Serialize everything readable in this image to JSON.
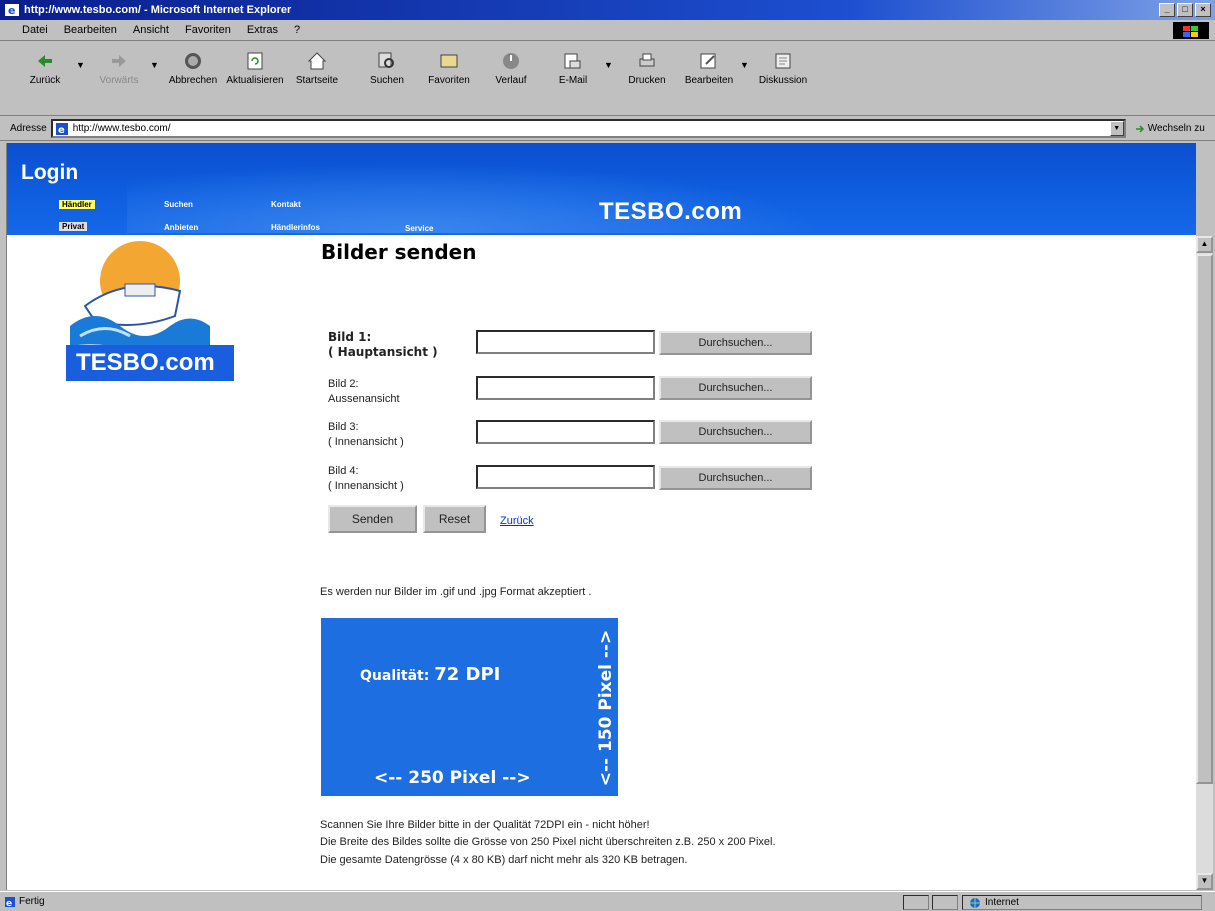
{
  "window": {
    "title": "http://www.tesbo.com/ - Microsoft Internet Explorer",
    "buttons": [
      "_",
      "□",
      "×"
    ]
  },
  "menu": [
    "Datei",
    "Bearbeiten",
    "Ansicht",
    "Favoriten",
    "Extras",
    "?"
  ],
  "toolbar": {
    "back": "Zurück",
    "forward": "Vorwärts",
    "stop": "Abbrechen",
    "refresh": "Aktualisieren",
    "home": "Startseite",
    "search": "Suchen",
    "favorites": "Favoriten",
    "history": "Verlauf",
    "mail": "E-Mail",
    "print": "Drucken",
    "edit": "Bearbeiten",
    "discuss": "Diskussion"
  },
  "address": {
    "label": "Adresse",
    "url": "http://www.tesbo.com/",
    "go": "Wechseln zu"
  },
  "banner": {
    "login": "Login",
    "nav": {
      "haendler": "Händler",
      "privat": "Privat",
      "suchen": "Suchen",
      "anbieten": "Anbieten",
      "kontakt": "Kontakt",
      "haendlerinfos": "Händlerinfos",
      "service": "Service"
    },
    "brand": "TESBO.com"
  },
  "logo_text": "TESBO.com",
  "page": {
    "title": "Bilder senden",
    "rows": [
      {
        "line1": "Bild 1:",
        "line2": "( Hauptansicht )",
        "browse": "Durchsuchen..."
      },
      {
        "line1": "Bild 2:",
        "line2": "Aussenansicht",
        "browse": "Durchsuchen..."
      },
      {
        "line1": "Bild 3:",
        "line2": "( Innenansicht )",
        "browse": "Durchsuchen..."
      },
      {
        "line1": "Bild 4:",
        "line2": "( Innenansicht )",
        "browse": "Durchsuchen..."
      }
    ],
    "send": "Senden",
    "reset": "Reset",
    "back": "Zurück",
    "format_note": "Es werden nur Bilder im .gif und .jpg Format akzeptiert .",
    "dim_box": {
      "quality_label": "Qualität:",
      "quality_value": "72 DPI",
      "width": "<-- 250 Pixel -->",
      "height": "<-- 150 Pixel -->"
    },
    "info": [
      "Scannen Sie Ihre Bilder bitte in der Qualität 72DPI ein - nicht höher!",
      "Die Breite des Bildes sollte die Grösse von 250 Pixel nicht überschreiten z.B. 250 x 200 Pixel.",
      "Die gesamte Datengrösse (4 x 80 KB) darf nicht mehr als 320 KB betragen."
    ]
  },
  "status": {
    "text": "Fertig",
    "zone": "Internet"
  }
}
